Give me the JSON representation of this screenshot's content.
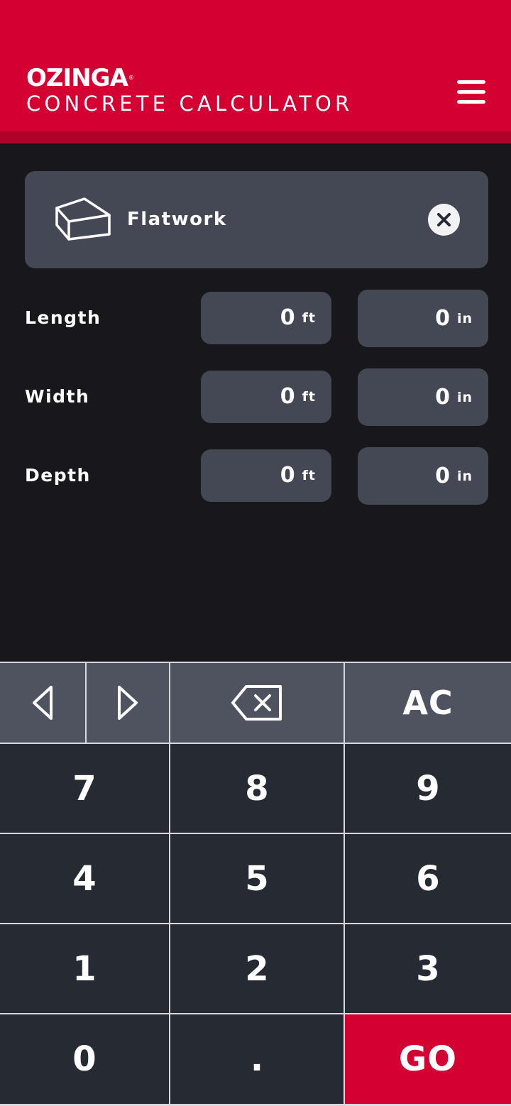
{
  "header": {
    "brand": "OZINGA",
    "brand_mark": "®",
    "title": "CONCRETE CALCULATOR",
    "menu_icon": "hamburger-menu-icon"
  },
  "project": {
    "icon": "slab-icon",
    "name": "Flatwork",
    "clear_icon": "close-circle-icon"
  },
  "dimensions": [
    {
      "label": "Length",
      "feet": "0",
      "feet_unit": "ft",
      "inches": "0",
      "inches_unit": "in"
    },
    {
      "label": "Width",
      "feet": "0",
      "feet_unit": "ft",
      "inches": "0",
      "inches_unit": "in"
    },
    {
      "label": "Depth",
      "feet": "0",
      "feet_unit": "ft",
      "inches": "0",
      "inches_unit": "in"
    }
  ],
  "keypad": {
    "prev_icon": "triangle-left-icon",
    "next_icon": "triangle-right-icon",
    "backspace_icon": "backspace-icon",
    "clear_all": "AC",
    "digits": [
      "7",
      "8",
      "9",
      "4",
      "5",
      "6",
      "1",
      "2",
      "3",
      "0"
    ],
    "decimal": ".",
    "go": "GO"
  },
  "colors": {
    "brand_red": "#d30031",
    "background": "#17171c",
    "card": "#444854",
    "key_top": "#4f535f",
    "key_num": "#262a33"
  }
}
